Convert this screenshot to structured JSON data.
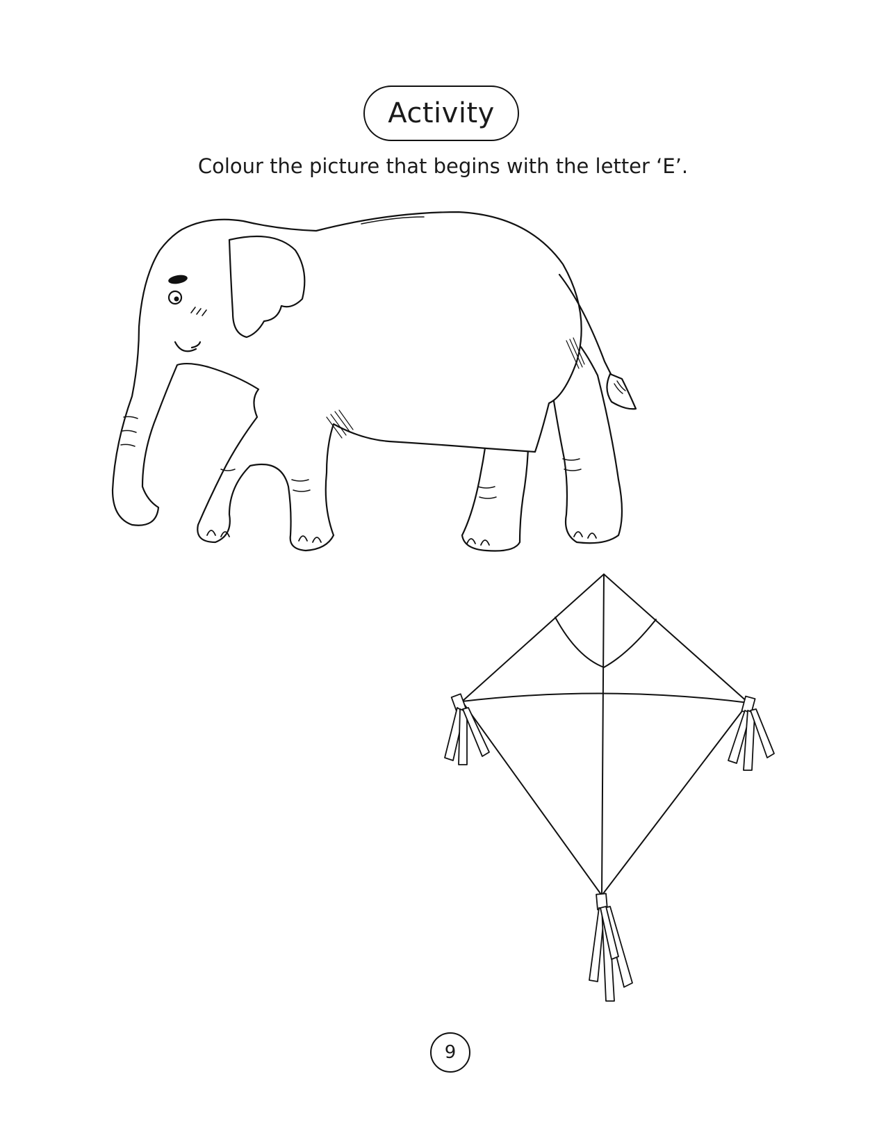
{
  "page": {
    "title": "Activity",
    "instruction": "Colour the picture that begins with the letter ‘E’.",
    "page_number": "9"
  },
  "illustrations": {
    "items": [
      "elephant",
      "kite"
    ],
    "line_color": "#111111",
    "fill_color": "#ffffff"
  }
}
